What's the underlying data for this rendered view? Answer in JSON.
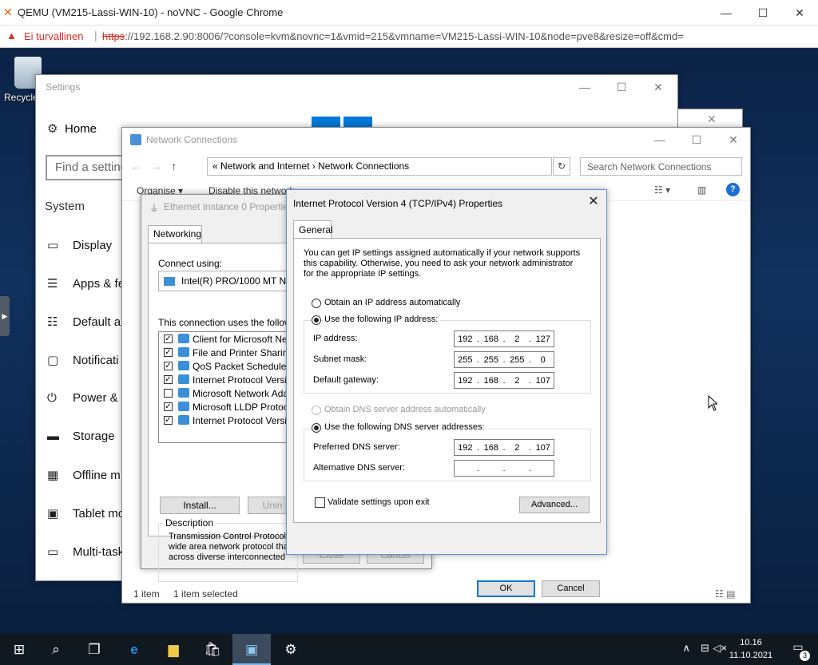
{
  "browser": {
    "tab_title": "QEMU (VM215-Lassi-WIN-10) - noVNC - Google Chrome",
    "security_label": "Ei turvallinen",
    "url_scheme": "https",
    "url_rest": "://192.168.2.90:8006/?console=kvm&novnc=1&vmid=215&vmname=VM215-Lassi-WIN-10&node=pve8&resize=off&cmd=",
    "minimize": "—",
    "maximize": "☐",
    "close": "✕"
  },
  "desktop": {
    "recycle_bin": "Recycle"
  },
  "settings": {
    "title": "Settings",
    "home": "Home",
    "find_placeholder": "Find a setting",
    "section": "System",
    "nav": [
      "Display",
      "Apps & fe",
      "Default a",
      "Notificati",
      "Power & s",
      "Storage",
      "Offline m",
      "Tablet mo",
      "Multi-task"
    ]
  },
  "network_connections": {
    "title": "Network Connections",
    "breadcrumb_prefix": "«",
    "breadcrumb_1": "Network and Internet",
    "breadcrumb_sep": "›",
    "breadcrumb_2": "Network Connections",
    "search_placeholder": "Search Network Connections",
    "toolbar_organise": "Organise ▾",
    "toolbar_disable": "Disable this network",
    "status_count": "1 item",
    "status_selected": "1 item selected"
  },
  "ethernet_properties": {
    "title": "Ethernet Instance 0 Properties",
    "tab": "Networking",
    "connect_using_label": "Connect using:",
    "adapter": "Intel(R) PRO/1000 MT Net",
    "items_label": "This connection uses the following",
    "items": [
      {
        "checked": true,
        "label": "Client for Microsoft Netwo"
      },
      {
        "checked": true,
        "label": "File and Printer Sharing fo"
      },
      {
        "checked": true,
        "label": "QoS Packet Scheduler"
      },
      {
        "checked": true,
        "label": "Internet Protocol Version"
      },
      {
        "checked": false,
        "label": "Microsoft Network Adapt"
      },
      {
        "checked": true,
        "label": "Microsoft LLDP Protocol"
      },
      {
        "checked": true,
        "label": "Internet Protocol Version"
      }
    ],
    "install_button": "Install...",
    "uninstall_button": "Unin",
    "description_label": "Description",
    "description_line_1": "Transmission Control Protocol/I",
    "description_line_2": "wide area network protocol tha",
    "description_line_3": "across diverse interconnected",
    "close_button": "Close",
    "cancel_button": "Cancel"
  },
  "ipv4_dialog": {
    "title": "Internet Protocol Version 4 (TCP/IPv4) Properties",
    "close": "✕",
    "tab": "General",
    "intro_line_1": "You can get IP settings assigned automatically if your network supports",
    "intro_line_2": "this capability. Otherwise, you need to ask your network administrator",
    "intro_line_3": "for the appropriate IP settings.",
    "obtain_ip_auto": "Obtain an IP address automatically",
    "use_following_ip": "Use the following IP address:",
    "ip_address_label": "IP address:",
    "ip_address": [
      "192",
      "168",
      "2",
      "127"
    ],
    "subnet_mask_label": "Subnet mask:",
    "subnet_mask": [
      "255",
      "255",
      "255",
      "0"
    ],
    "default_gateway_label": "Default gateway:",
    "default_gateway": [
      "192",
      "168",
      "2",
      "107"
    ],
    "obtain_dns_auto": "Obtain DNS server address automatically",
    "use_following_dns": "Use the following DNS server addresses:",
    "preferred_dns_label": "Preferred DNS server:",
    "preferred_dns": [
      "192",
      "168",
      "2",
      "107"
    ],
    "alternative_dns_label": "Alternative DNS server:",
    "alternative_dns": [
      "",
      "",
      "",
      ""
    ],
    "dot": ".",
    "validate_label": "Validate settings upon exit",
    "advanced_button": "Advanced...",
    "ok_button": "OK",
    "cancel_button": "Cancel"
  },
  "taskbar": {
    "time": "10.16",
    "date": "11.10.2021",
    "notifications_count": "3"
  }
}
